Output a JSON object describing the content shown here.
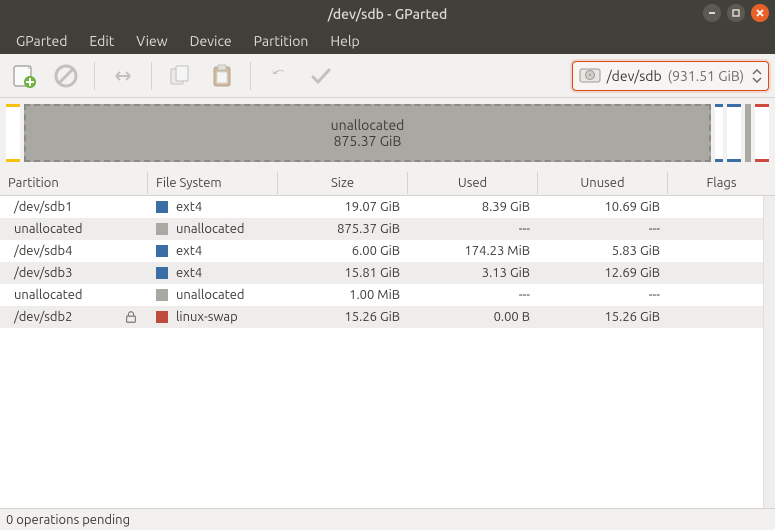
{
  "window": {
    "title": "/dev/sdb - GParted"
  },
  "menubar": [
    "GParted",
    "Edit",
    "View",
    "Device",
    "Partition",
    "Help"
  ],
  "device_selector": {
    "device": "/dev/sdb",
    "size": "(931.51 GiB)"
  },
  "diskbar": {
    "unalloc_label": "unallocated",
    "unalloc_size": "875.37 GiB"
  },
  "columns": {
    "partition": "Partition",
    "filesystem": "File System",
    "size": "Size",
    "used": "Used",
    "unused": "Unused",
    "flags": "Flags"
  },
  "fs_colors": {
    "ext4": "#3b6ea5",
    "unallocated": "#a9a8a3",
    "linux-swap": "#bf4a3f"
  },
  "rows": [
    {
      "partition": "/dev/sdb1",
      "lock": false,
      "fs": "ext4",
      "size": "19.07 GiB",
      "used": "8.39 GiB",
      "unused": "10.69 GiB",
      "flags": ""
    },
    {
      "partition": "unallocated",
      "lock": false,
      "fs": "unallocated",
      "size": "875.37 GiB",
      "used": "---",
      "unused": "---",
      "flags": ""
    },
    {
      "partition": "/dev/sdb4",
      "lock": false,
      "fs": "ext4",
      "size": "6.00 GiB",
      "used": "174.23 MiB",
      "unused": "5.83 GiB",
      "flags": ""
    },
    {
      "partition": "/dev/sdb3",
      "lock": false,
      "fs": "ext4",
      "size": "15.81 GiB",
      "used": "3.13 GiB",
      "unused": "12.69 GiB",
      "flags": ""
    },
    {
      "partition": "unallocated",
      "lock": false,
      "fs": "unallocated",
      "size": "1.00 MiB",
      "used": "---",
      "unused": "---",
      "flags": ""
    },
    {
      "partition": "/dev/sdb2",
      "lock": true,
      "fs": "linux-swap",
      "size": "15.26 GiB",
      "used": "0.00 B",
      "unused": "15.26 GiB",
      "flags": ""
    }
  ],
  "statusbar": {
    "text": "0 operations pending"
  }
}
